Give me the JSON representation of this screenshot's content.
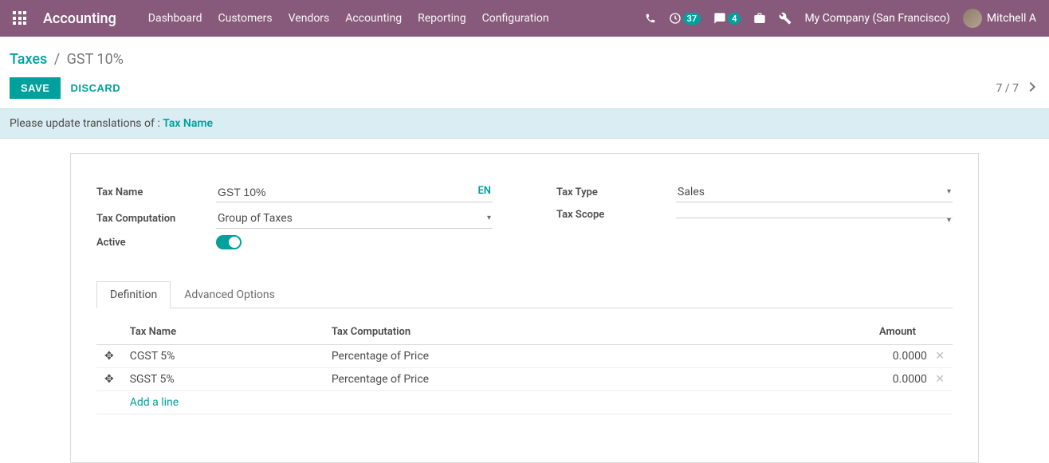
{
  "header": {
    "app_title": "Accounting",
    "menu": [
      "Dashboard",
      "Customers",
      "Vendors",
      "Accounting",
      "Reporting",
      "Configuration"
    ],
    "activity_badge": "37",
    "chat_badge": "4",
    "company": "My Company (San Francisco)",
    "user": "Mitchell A"
  },
  "breadcrumb": {
    "parent": "Taxes",
    "current": "GST 10%"
  },
  "buttons": {
    "save": "SAVE",
    "discard": "DISCARD"
  },
  "pager": {
    "text": "7 / 7"
  },
  "alert": {
    "prefix": "Please update translations of : ",
    "field": "Tax Name"
  },
  "form": {
    "labels": {
      "tax_name": "Tax Name",
      "tax_computation": "Tax Computation",
      "active": "Active",
      "tax_type": "Tax Type",
      "tax_scope": "Tax Scope"
    },
    "values": {
      "tax_name": "GST 10%",
      "tax_computation": "Group of Taxes",
      "tax_type": "Sales",
      "tax_scope": ""
    },
    "lang_btn": "EN"
  },
  "tabs": {
    "definition": "Definition",
    "advanced": "Advanced Options"
  },
  "table": {
    "headers": {
      "tax_name": "Tax Name",
      "tax_computation": "Tax Computation",
      "amount": "Amount"
    },
    "rows": [
      {
        "name": "CGST 5%",
        "computation": "Percentage of Price",
        "amount": "0.0000"
      },
      {
        "name": "SGST 5%",
        "computation": "Percentage of Price",
        "amount": "0.0000"
      }
    ],
    "add_line": "Add a line"
  }
}
